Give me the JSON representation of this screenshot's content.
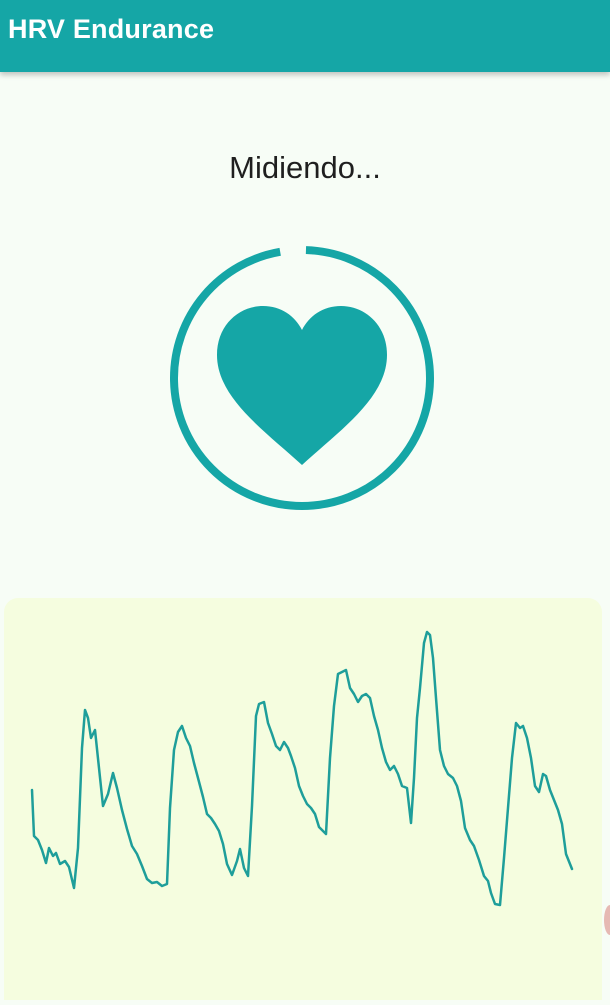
{
  "app_bar": {
    "title": "HRV Endurance",
    "color": "#15a6a6"
  },
  "measurement": {
    "status": "Midiendo...",
    "icon": "heart-icon",
    "progress": 0.97,
    "accent": "#15a6a6"
  },
  "waveform": {
    "background": "#f5fddf",
    "line_color": "#1e9e9a"
  }
}
